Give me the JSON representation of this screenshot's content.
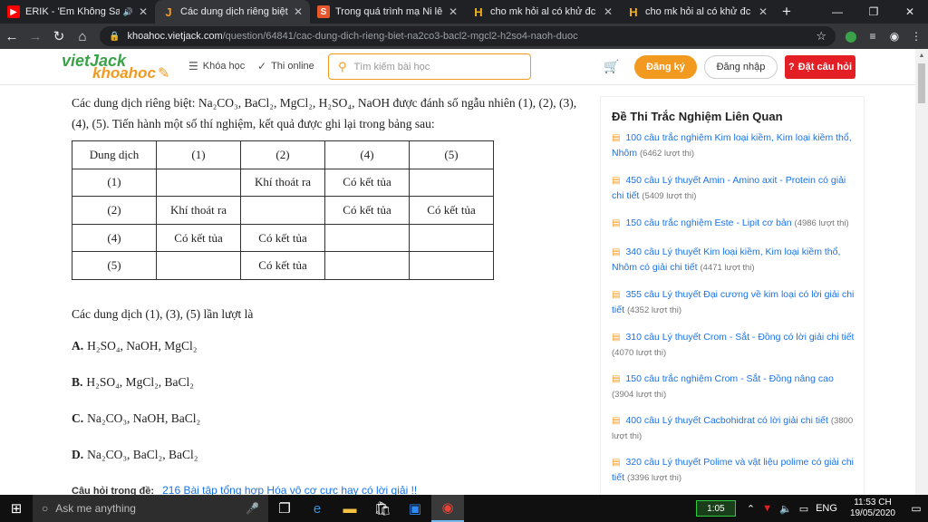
{
  "browser": {
    "tabs": [
      {
        "title": "ERIK - 'Em Không Sai, Chú",
        "favicon": "youtube-icon",
        "color": "#ff0000",
        "active": false
      },
      {
        "title": "Các dung dịch riêng biệt: Na2C",
        "favicon": "vietjack-icon",
        "color": "#f29a1f",
        "active": true
      },
      {
        "title": "Trong quá trình mạ Ni lên một",
        "favicon": "s-icon",
        "color": "#e8572b",
        "active": false
      },
      {
        "title": "cho mk hỏi al có khử đc oxit a",
        "favicon": "h-icon",
        "color": "#f5b21a",
        "active": false
      },
      {
        "title": "cho mk hỏi al có khử đc oxit a",
        "favicon": "h-icon",
        "color": "#f5b21a",
        "active": false
      }
    ],
    "url_domain": "khoahoc.vietjack.com",
    "url_path": "/question/64841/cac-dung-dich-rieng-biet-na2co3-bacl2-mgcl2-h2so4-naoh-duoc"
  },
  "site": {
    "logo_top": "vietJack",
    "logo_bottom": "khoahoc",
    "nav_courses": "Khóa học",
    "nav_quiz": "Thi online",
    "search_placeholder": "Tìm kiếm bài học",
    "signup": "Đăng ký",
    "login": "Đăng nhập",
    "ask": "Đặt câu hỏi"
  },
  "question": {
    "intro": "Các dung dịch riêng biệt: Na₂CO₃, BaCl₂, MgCl₂, H₂SO₄, NaOH được đánh số ngẫu nhiên (1), (2), (3), (4), (5). Tiến hành một số thí nghiệm, kết quả được ghi lại trong bảng sau:",
    "table": {
      "header": [
        "Dung dịch",
        "(1)",
        "(2)",
        "(4)",
        "(5)"
      ],
      "rows": [
        [
          "(1)",
          "",
          "Khí thoát ra",
          "Có kết tủa",
          ""
        ],
        [
          "(2)",
          "Khí thoát ra",
          "",
          "Có kết tủa",
          "Có kết tủa"
        ],
        [
          "(4)",
          "Có kết tủa",
          "Có kết tủa",
          "",
          ""
        ],
        [
          "(5)",
          "",
          "Có kết tủa",
          "",
          ""
        ]
      ]
    },
    "prompt": "Các dung dịch (1), (3), (5) lần lượt là",
    "options": [
      {
        "letter": "A.",
        "text": "H₂SO₄, NaOH, MgCl₂"
      },
      {
        "letter": "B.",
        "text": "H₂SO₄, MgCl₂, BaCl₂"
      },
      {
        "letter": "C.",
        "text": "Na₂CO₃, NaOH, BaCl₂"
      },
      {
        "letter": "D.",
        "text": "Na₂CO₃, BaCl₂, BaCl₂"
      }
    ],
    "related_label": "Câu hỏi trong đề:",
    "related_link": "216 Bài tập tổng hợp Hóa vô cơ cực hay có lời giải !!"
  },
  "sidebar": {
    "title": "Đề Thi Trắc Nghiệm Liên Quan",
    "items": [
      {
        "text": "100 câu trắc nghiệm Kim loại kiềm, Kim loại kiềm thổ, Nhôm",
        "count": "(6462 lượt thi)"
      },
      {
        "text": "450 câu Lý thuyết Amin - Amino axit - Protein có giải chi tiết",
        "count": "(5409 lượt thi)"
      },
      {
        "text": "150 câu trắc nghiệm Este - Lipit cơ bản",
        "count": "(4986 lượt thi)"
      },
      {
        "text": "340 câu Lý thuyết Kim loại kiềm, Kim loại kiềm thổ, Nhôm có giải chi tiết",
        "count": "(4471 lượt thi)"
      },
      {
        "text": "355 câu Lý thuyết Đại cương về kim loại có lời giải chi tiết",
        "count": "(4352 lượt thi)"
      },
      {
        "text": "310 câu Lý thuyết Crom - Sắt - Đồng có lời giải chi tiết",
        "count": "(4070 lượt thi)"
      },
      {
        "text": "150 câu trắc nghiệm Crom - Sắt - Đồng nâng cao",
        "count": "(3904 lượt thi)"
      },
      {
        "text": "400 câu Lý thuyết Cacbohidrat có lời giải chi tiết",
        "count": "(3800 lượt thi)"
      },
      {
        "text": "320 câu Lý thuyết Polime và vật liệu polime có giải chi tiết",
        "count": "(3396 lượt thi)"
      }
    ]
  },
  "taskbar": {
    "search_placeholder": "Ask me anything",
    "battery": "1:05",
    "lang": "ENG",
    "time": "11:53 CH",
    "date": "19/05/2020"
  }
}
